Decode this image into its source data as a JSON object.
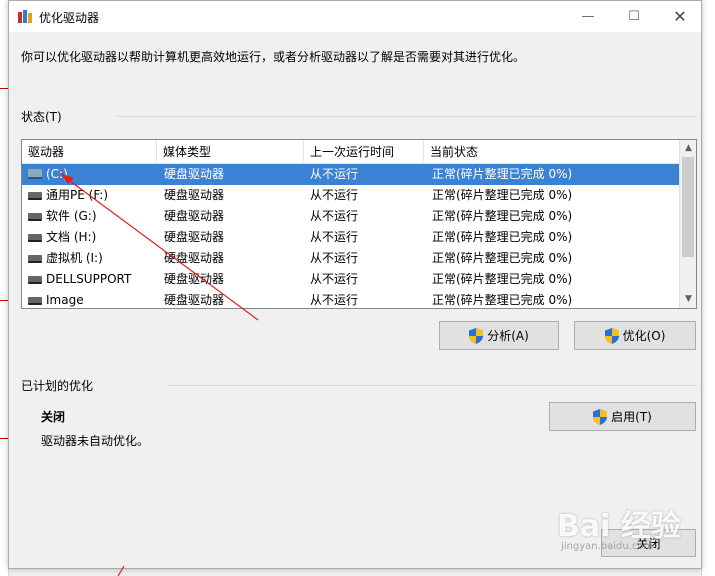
{
  "window": {
    "title": "优化驱动器",
    "minimize": "—",
    "maximize": "☐",
    "close": "✕"
  },
  "intro": "你可以优化驱动器以帮助计算机更高效地运行，或者分析驱动器以了解是否需要对其进行优化。",
  "status_section": {
    "label": "状态(T)"
  },
  "table": {
    "columns": [
      "驱动器",
      "媒体类型",
      "上一次运行时间",
      "当前状态"
    ],
    "rows": [
      {
        "name": "(C:)",
        "type": "硬盘驱动器",
        "last_run": "从不运行",
        "status": "正常(碎片整理已完成 0%)",
        "selected": true
      },
      {
        "name": "通用PE (F:)",
        "type": "硬盘驱动器",
        "last_run": "从不运行",
        "status": "正常(碎片整理已完成 0%)",
        "selected": false
      },
      {
        "name": "软件 (G:)",
        "type": "硬盘驱动器",
        "last_run": "从不运行",
        "status": "正常(碎片整理已完成 0%)",
        "selected": false
      },
      {
        "name": "文档 (H:)",
        "type": "硬盘驱动器",
        "last_run": "从不运行",
        "status": "正常(碎片整理已完成 0%)",
        "selected": false
      },
      {
        "name": "虚拟机 (I:)",
        "type": "硬盘驱动器",
        "last_run": "从不运行",
        "status": "正常(碎片整理已完成 0%)",
        "selected": false
      },
      {
        "name": "DELLSUPPORT",
        "type": "硬盘驱动器",
        "last_run": "从不运行",
        "status": "正常(碎片整理已完成 0%)",
        "selected": false
      },
      {
        "name": "Image",
        "type": "硬盘驱动器",
        "last_run": "从不运行",
        "status": "正常(碎片整理已完成 0%)",
        "selected": false
      }
    ]
  },
  "buttons": {
    "analyze": "分析(A)",
    "optimize": "优化(O)",
    "enable": "启用(T)",
    "close": "关闭"
  },
  "scheduled": {
    "label": "已计划的优化",
    "state": "关闭",
    "description": "驱动器未自动优化。"
  },
  "watermark": {
    "logo": "Bai 经验",
    "sub": "jingyan.baidu.com"
  },
  "colors": {
    "selection": "#3c82d4",
    "annotation": "#e02020",
    "shield_blue": "#2a6fd6",
    "shield_yellow": "#f2c21b"
  }
}
